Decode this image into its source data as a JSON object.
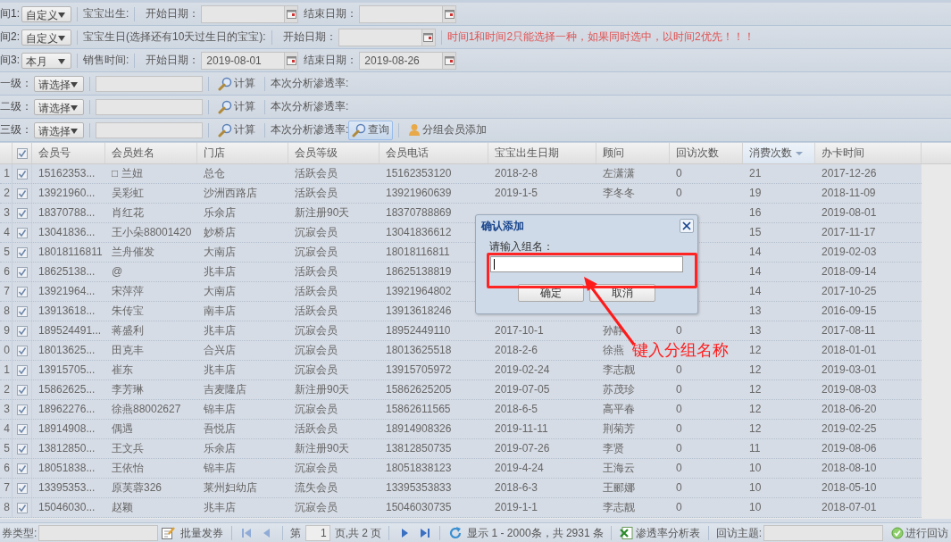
{
  "filters": [
    {
      "label": "间1:",
      "items": [
        {
          "kind": "select",
          "value": "自定义"
        },
        {
          "kind": "sep"
        },
        {
          "kind": "text",
          "text": "宝宝出生:"
        },
        {
          "kind": "sep"
        },
        {
          "kind": "date",
          "label": "开始日期："
        },
        {
          "kind": "date",
          "label": "结束日期："
        }
      ]
    },
    {
      "label": "间2:",
      "items": [
        {
          "kind": "select",
          "value": "自定义"
        },
        {
          "kind": "sep"
        },
        {
          "kind": "text",
          "text": "宝宝生日(选择还有10天过生日的宝宝):"
        },
        {
          "kind": "sep"
        },
        {
          "kind": "date",
          "label": "开始日期："
        },
        {
          "kind": "sep"
        },
        {
          "kind": "note",
          "text": "时间1和时间2只能选择一种，如果同时选中，以时间2优先！！！"
        }
      ]
    },
    {
      "label": "间3:",
      "items": [
        {
          "kind": "select",
          "value": "本月"
        },
        {
          "kind": "sep"
        },
        {
          "kind": "text",
          "text": "销售时间:"
        },
        {
          "kind": "sep"
        },
        {
          "kind": "date",
          "label": "开始日期：",
          "value": "2019-08-01"
        },
        {
          "kind": "date",
          "label": "结束日期：",
          "value": "2019-08-26"
        }
      ]
    },
    {
      "label": "一级：",
      "items": [
        {
          "kind": "select",
          "value": "请选择"
        },
        {
          "kind": "sep"
        },
        {
          "kind": "input"
        },
        {
          "kind": "sep"
        },
        {
          "kind": "search",
          "text": "计算",
          "pressed": false
        },
        {
          "kind": "sep"
        },
        {
          "kind": "text",
          "text": "本次分析渗透率:"
        }
      ]
    },
    {
      "label": "二级：",
      "items": [
        {
          "kind": "select",
          "value": "请选择"
        },
        {
          "kind": "sep"
        },
        {
          "kind": "input"
        },
        {
          "kind": "sep"
        },
        {
          "kind": "search",
          "text": "计算",
          "pressed": false
        },
        {
          "kind": "sep"
        },
        {
          "kind": "text",
          "text": "本次分析渗透率:"
        }
      ]
    },
    {
      "label": "三级：",
      "items": [
        {
          "kind": "select",
          "value": "请选择"
        },
        {
          "kind": "sep"
        },
        {
          "kind": "input"
        },
        {
          "kind": "sep"
        },
        {
          "kind": "search",
          "text": "计算",
          "pressed": false
        },
        {
          "kind": "sep"
        },
        {
          "kind": "text",
          "text": "本次分析渗透率:"
        },
        {
          "kind": "search",
          "text": "查询",
          "pressed": true
        },
        {
          "kind": "sep"
        },
        {
          "kind": "add",
          "text": "分组会员添加",
          "pressed": false
        }
      ]
    }
  ],
  "table": {
    "header_checked": true,
    "columns": [
      {
        "label": "会员号",
        "sorted": false
      },
      {
        "label": "会员姓名",
        "sorted": false
      },
      {
        "label": "门店",
        "sorted": false
      },
      {
        "label": "会员等级",
        "sorted": false
      },
      {
        "label": "会员电话",
        "sorted": false
      },
      {
        "label": "宝宝出生日期",
        "sorted": false
      },
      {
        "label": "顾问",
        "sorted": false
      },
      {
        "label": "回访次数",
        "sorted": false
      },
      {
        "label": "消费次数",
        "sorted": true
      },
      {
        "label": "办卡时间",
        "sorted": false
      }
    ],
    "rows": [
      {
        "num": "1",
        "checked": true,
        "cells": [
          "15162353...",
          "□ 兰妞",
          "总仓",
          "活跃会员",
          "15162353120",
          "2018-2-8",
          "左潇潇",
          "0",
          "21",
          "2017-12-26"
        ]
      },
      {
        "num": "2",
        "checked": true,
        "cells": [
          "13921960...",
          "吴彩虹",
          "沙洲西路店",
          "活跃会员",
          "13921960639",
          "2019-1-5",
          "李冬冬",
          "0",
          "19",
          "2018-11-09"
        ]
      },
      {
        "num": "3",
        "checked": true,
        "cells": [
          "18370788...",
          "肖红花",
          "乐余店",
          "新注册90天",
          "18370788869",
          null,
          null,
          null,
          "16",
          "2019-08-01"
        ]
      },
      {
        "num": "4",
        "checked": true,
        "cells": [
          "13041836...",
          "王小朵88001420",
          "妙桥店",
          "沉寂会员",
          "13041836612",
          null,
          null,
          null,
          "15",
          "2017-11-17"
        ]
      },
      {
        "num": "5",
        "checked": true,
        "cells": [
          "18018116811",
          "兰舟催发",
          "大南店",
          "沉寂会员",
          "18018116811",
          null,
          null,
          null,
          "14",
          "2019-02-03"
        ]
      },
      {
        "num": "6",
        "checked": true,
        "cells": [
          "18625138...",
          "@",
          "兆丰店",
          "活跃会员",
          "18625138819",
          null,
          null,
          null,
          "14",
          "2018-09-14"
        ]
      },
      {
        "num": "7",
        "checked": true,
        "cells": [
          "13921964...",
          "宋萍萍",
          "大南店",
          "活跃会员",
          "13921964802",
          null,
          null,
          null,
          "14",
          "2017-10-25"
        ]
      },
      {
        "num": "8",
        "checked": true,
        "cells": [
          "13913618...",
          "朱传宝",
          "南丰店",
          "活跃会员",
          "13913618246",
          null,
          null,
          null,
          "13",
          "2016-09-15"
        ]
      },
      {
        "num": "9",
        "checked": true,
        "cells": [
          "189524491...",
          "蒋盛利",
          "兆丰店",
          "沉寂会员",
          "18952449110",
          "2017-10-1",
          "孙静",
          "0",
          "13",
          "2017-08-11"
        ]
      },
      {
        "num": "0",
        "checked": true,
        "cells": [
          "18013625...",
          "田克丰",
          "合兴店",
          "沉寂会员",
          "18013625518",
          "2018-2-6",
          "徐燕",
          null,
          "12",
          "2018-01-01"
        ]
      },
      {
        "num": "1",
        "checked": true,
        "cells": [
          "13915705...",
          "崔东",
          "兆丰店",
          "沉寂会员",
          "13915705972",
          "2019-02-24",
          "李志靓",
          "0",
          "12",
          "2019-03-01"
        ]
      },
      {
        "num": "2",
        "checked": true,
        "cells": [
          "15862625...",
          "李芳琳",
          "吉麦隆店",
          "新注册90天",
          "15862625205",
          "2019-07-05",
          "苏茂珍",
          "0",
          "12",
          "2019-08-03"
        ]
      },
      {
        "num": "3",
        "checked": true,
        "cells": [
          "18962276...",
          "徐燕88002627",
          "锦丰店",
          "沉寂会员",
          "15862611565",
          "2018-6-5",
          "高平春",
          "0",
          "12",
          "2018-06-20"
        ]
      },
      {
        "num": "4",
        "checked": true,
        "cells": [
          "18914908...",
          "偶遇",
          "吾悦店",
          "活跃会员",
          "18914908326",
          "2019-11-11",
          "荆菊芳",
          "0",
          "12",
          "2019-02-25"
        ]
      },
      {
        "num": "5",
        "checked": true,
        "cells": [
          "13812850...",
          "王文兵",
          "乐余店",
          "新注册90天",
          "13812850735",
          "2019-07-26",
          "李贤",
          "0",
          "11",
          "2019-08-06"
        ]
      },
      {
        "num": "6",
        "checked": true,
        "cells": [
          "18051838...",
          "王依怡",
          "锦丰店",
          "沉寂会员",
          "18051838123",
          "2019-4-24",
          "王海云",
          "0",
          "10",
          "2018-08-10"
        ]
      },
      {
        "num": "7",
        "checked": true,
        "cells": [
          "13395353...",
          "原芙蓉326",
          "莱州妇幼店",
          "流失会员",
          "13395353833",
          "2018-6-3",
          "王郦娜",
          "0",
          "10",
          "2018-05-10"
        ]
      },
      {
        "num": "8",
        "checked": true,
        "cells": [
          "15046030...",
          "赵颖",
          "兆丰店",
          "沉寂会员",
          "15046030735",
          "2019-1-1",
          "李志靓",
          "0",
          "10",
          "2018-07-01"
        ]
      }
    ]
  },
  "toolbar": [
    {
      "kind": "text",
      "text": "券类型:"
    },
    {
      "kind": "input"
    },
    {
      "kind": "edit"
    },
    {
      "kind": "button",
      "text": "批量发券"
    },
    {
      "kind": "sep"
    },
    {
      "kind": "first",
      "disabled": true
    },
    {
      "kind": "prev",
      "disabled": true
    },
    {
      "kind": "sep"
    },
    {
      "kind": "text",
      "text": "第"
    },
    {
      "kind": "page",
      "value": "1"
    },
    {
      "kind": "text",
      "text": "页,共 2 页"
    },
    {
      "kind": "sep"
    },
    {
      "kind": "next",
      "disabled": false
    },
    {
      "kind": "last",
      "disabled": false
    },
    {
      "kind": "sep"
    },
    {
      "kind": "refresh"
    },
    {
      "kind": "text",
      "text": "显示 1 - 2000条，共 2931 条"
    },
    {
      "kind": "sep"
    },
    {
      "kind": "excel",
      "text": "渗透率分析表"
    },
    {
      "kind": "sep"
    },
    {
      "kind": "text",
      "text": "回访主题:"
    },
    {
      "kind": "input"
    },
    {
      "kind": "check",
      "text": "进行回访"
    }
  ],
  "dialog": {
    "title": "确认添加",
    "label": "请输入组名：",
    "buttons": [
      "确定",
      "取消"
    ]
  },
  "annotation": {
    "text": "键入分组名称"
  }
}
